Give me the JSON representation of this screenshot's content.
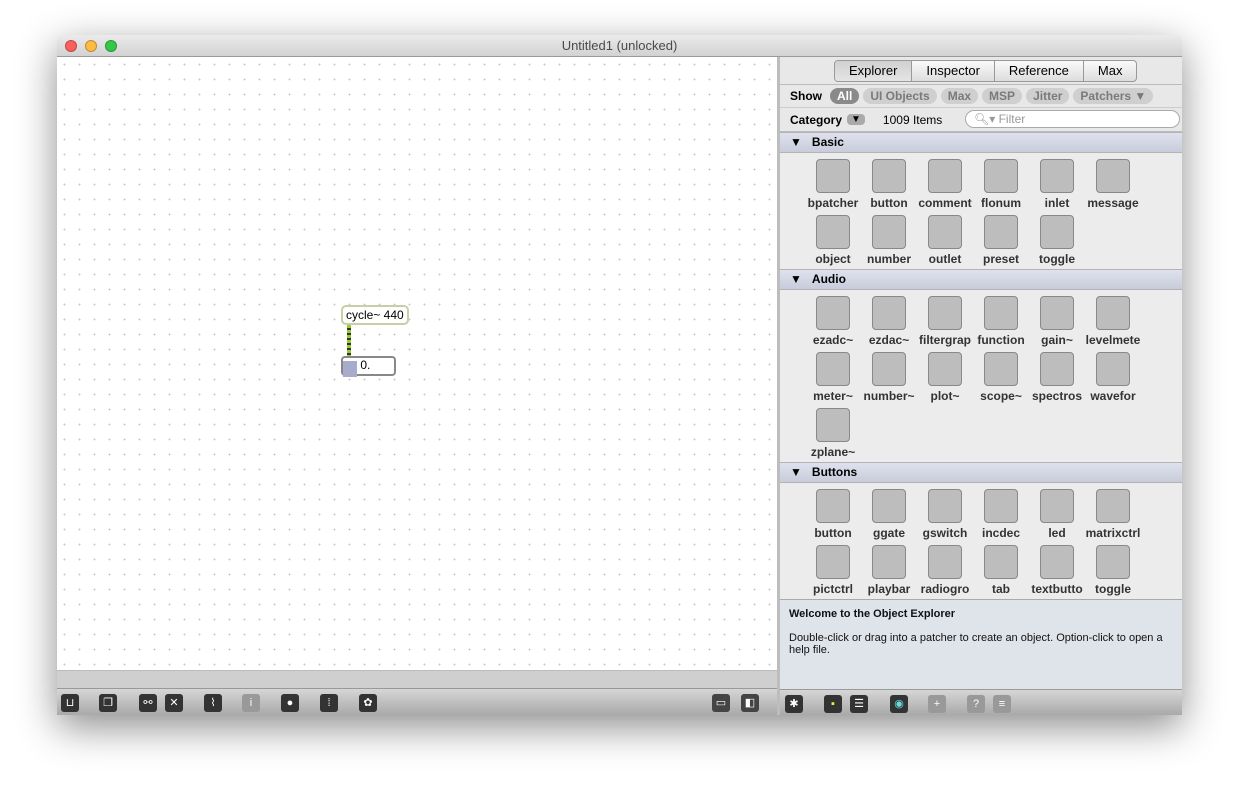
{
  "window": {
    "title": "Untitled1 (unlocked)"
  },
  "patcher": {
    "object_text": "cycle~ 440",
    "number_value": "0."
  },
  "patcher_toolbar": [
    {
      "icon": "lock-icon",
      "g": "⊔"
    },
    {
      "icon": "presentation-icon",
      "g": "❐"
    },
    {
      "icon": "binoculars-icon",
      "g": "⚯"
    },
    {
      "icon": "clear-icon",
      "g": "✕"
    },
    {
      "icon": "debug-icon",
      "g": "⌇"
    },
    {
      "icon": "info-icon",
      "g": "i"
    },
    {
      "icon": "connection-icon",
      "g": "●"
    },
    {
      "icon": "grid-icon",
      "g": "⁞"
    },
    {
      "icon": "palette-icon",
      "g": "✿"
    }
  ],
  "explorer": {
    "tabs": [
      "Explorer",
      "Inspector",
      "Reference",
      "Max"
    ],
    "show_label": "Show",
    "filters": [
      "All",
      "UI Objects",
      "Max",
      "MSP",
      "Jitter",
      "Patchers ▼"
    ],
    "category_label": "Category",
    "item_count": "1009 Items",
    "filter_placeholder": "Filter",
    "sections": [
      {
        "name": "Basic",
        "items": [
          "bpatcher",
          "button",
          "comment",
          "flonum",
          "inlet",
          "message",
          "object",
          "number",
          "outlet",
          "preset",
          "toggle"
        ]
      },
      {
        "name": "Audio",
        "items": [
          "ezadc~",
          "ezdac~",
          "filtergrap",
          "function",
          "gain~",
          "levelmete",
          "meter~",
          "number~",
          "plot~",
          "scope~",
          "spectros",
          "wavefor",
          "zplane~"
        ]
      },
      {
        "name": "Buttons",
        "items": [
          "button",
          "ggate",
          "gswitch",
          "incdec",
          "led",
          "matrixctrl",
          "pictctrl",
          "playbar",
          "radiogro",
          "tab",
          "textbutto",
          "toggle"
        ]
      }
    ],
    "info_title": "Welcome to the Object Explorer",
    "info_text": "Double-click or drag into a patcher to create an object. Option-click to open a help file."
  }
}
